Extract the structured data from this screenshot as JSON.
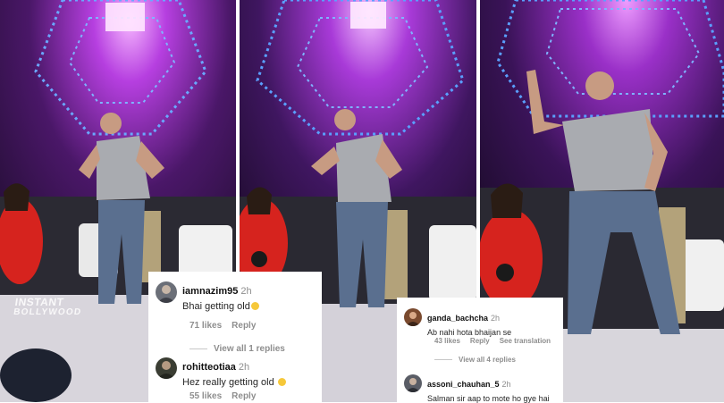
{
  "watermark": {
    "line1": "INSTANT",
    "line2": "BOLLYWOOD"
  },
  "colors": {
    "stage_purple": "#6a1a8c",
    "led_blue": "#5aa0ff",
    "dress_red": "#d6231e",
    "shirt_grey": "#a9abb0",
    "jeans_blue": "#5a6f8f"
  },
  "comments_card_1": [
    {
      "username": "iamnazim95",
      "time": "2h",
      "text": "Bhai getting old",
      "emoji": "smiling-face-icon",
      "likes": "71 likes",
      "reply": "Reply",
      "view_replies": "View all 1 replies"
    },
    {
      "username": "rohitteotiaa",
      "time": "2h",
      "text": "Hez really getting old",
      "emoji": "smiling-face-icon",
      "likes": "55 likes",
      "reply": "Reply"
    }
  ],
  "comments_card_2": [
    {
      "username": "ganda_bachcha",
      "time": "2h",
      "text": "Ab nahi hota bhaijan se",
      "likes": "43 likes",
      "reply": "Reply",
      "translation": "See translation",
      "view_replies": "View all 4 replies"
    },
    {
      "username": "assoni_chauhan_5",
      "time": "2h",
      "text": "Salman sir aap to mote ho gye hai"
    }
  ]
}
